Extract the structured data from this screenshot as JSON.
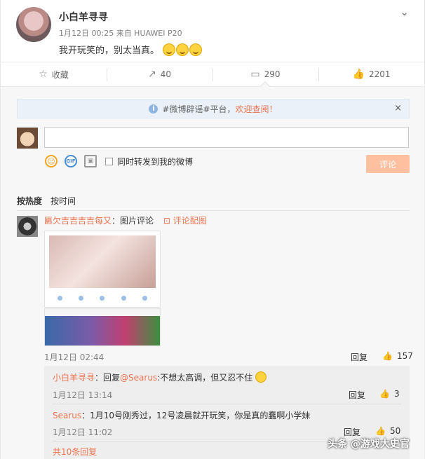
{
  "post": {
    "username": "小白羊寻寻",
    "meta": "1月12日 00:25 来自 HUAWEI P20",
    "text": "我开玩笑的，别太当真。"
  },
  "actions": {
    "favorite_label": "收藏",
    "repost_count": "40",
    "comment_count": "290",
    "like_count": "2201"
  },
  "notice": {
    "prefix": "#微博辟谣#平台，",
    "link": "欢迎查阅！",
    "close": "×"
  },
  "composer": {
    "input_value": "",
    "also_repost_label": "同时转发到我的微博",
    "submit_label": "评论"
  },
  "sort": {
    "hot": "按热度",
    "time": "按时间"
  },
  "comment": {
    "author": "匾欠吉吉吉吉每又",
    "text": "：图片评论",
    "pic_link": "评论配图",
    "time": "1月12日 02:44",
    "reply_label": "回复",
    "likes": "157"
  },
  "replies": [
    {
      "author": "小白羊寻寻",
      "text_prefix": "：回复",
      "mention": "@Searus",
      "text": ":不想太高调，但又忍不住",
      "time": "1月12日 13:14",
      "reply_label": "回复",
      "likes": "3"
    },
    {
      "author": "Searus",
      "text": "：1月10号刚秀过，12号凌晨就开玩笑，你是真的蠢啊小学妹",
      "time": "1月12日 11:02",
      "reply_label": "回复",
      "likes": "50"
    }
  ],
  "more_replies": "共10条回复",
  "watermark": "头条 @游戏大史官"
}
